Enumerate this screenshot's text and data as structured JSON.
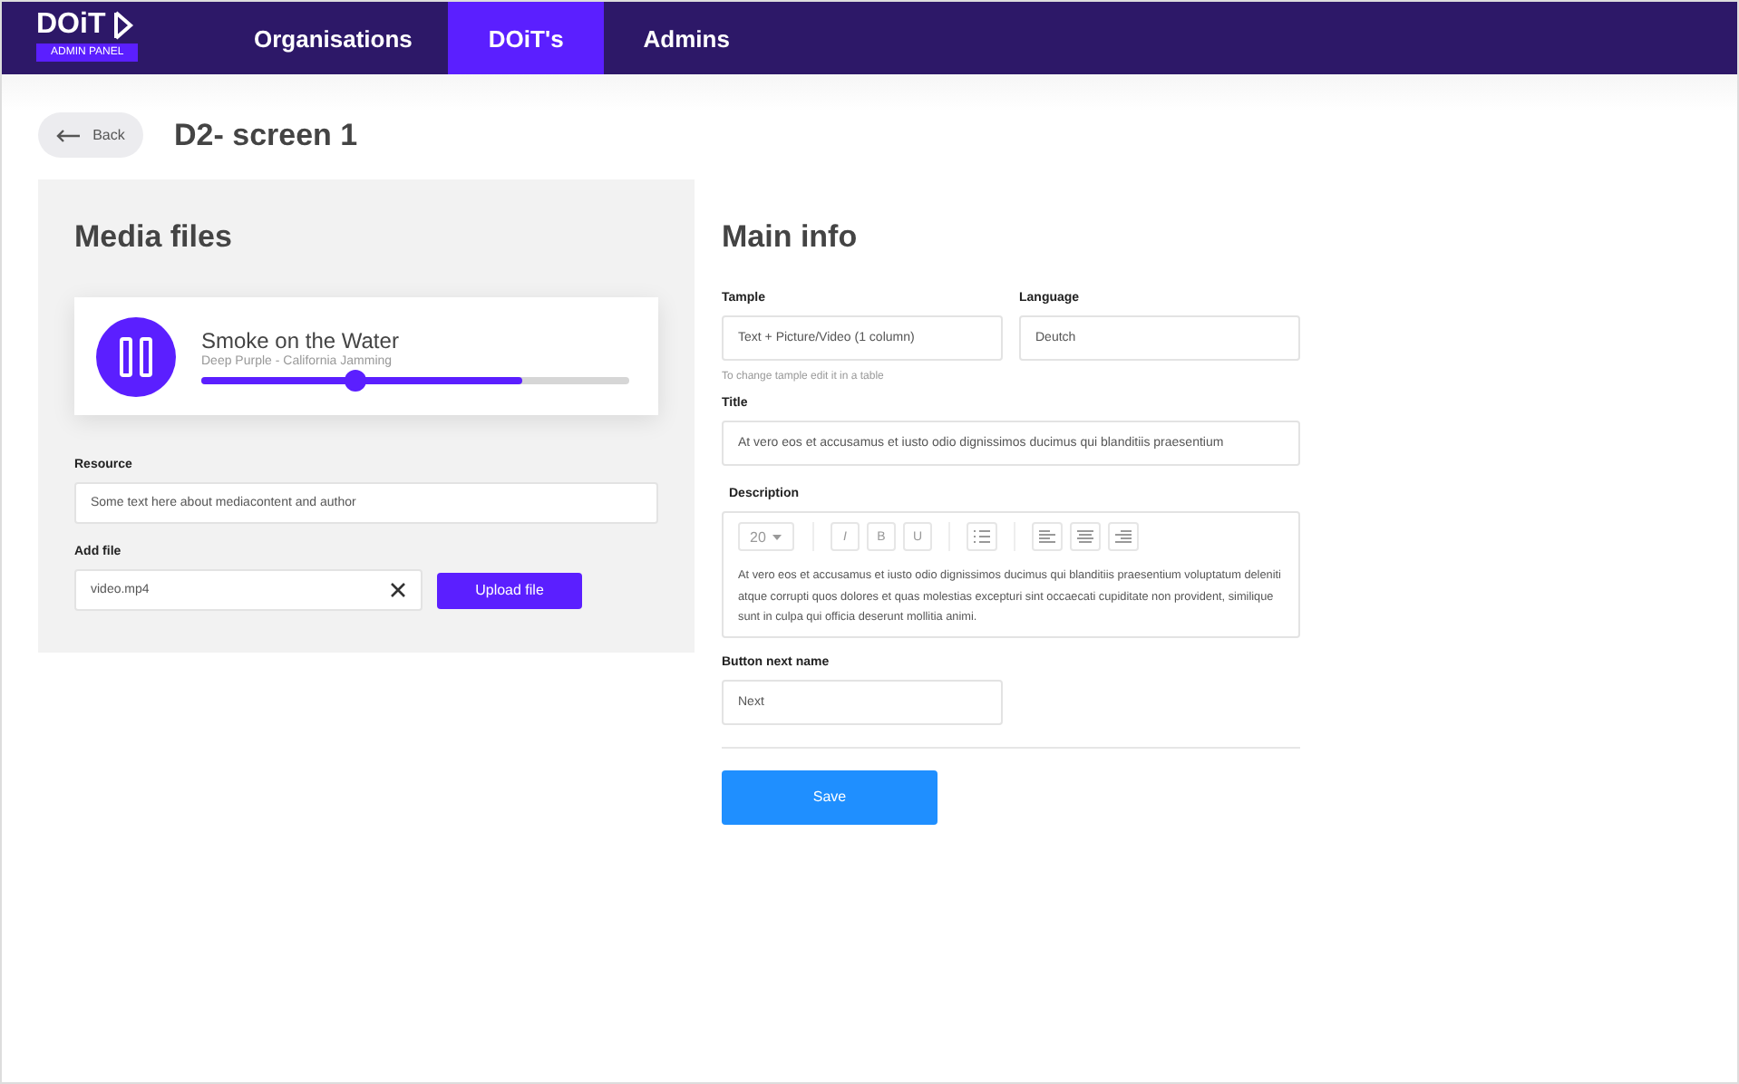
{
  "logo": {
    "text": "DOiT",
    "badge": "ADMIN PANEL"
  },
  "nav": [
    {
      "label": "Organisations",
      "selected": false
    },
    {
      "label": "DOiT's",
      "selected": true
    },
    {
      "label": "Admins",
      "selected": false
    }
  ],
  "back_button": "Back",
  "page_title": "D2- screen 1",
  "media": {
    "heading": "Media files",
    "player": {
      "title": "Smoke on the Water",
      "subtitle": "Deep Purple - California Jamming",
      "playing": true,
      "buffer": {
        "level": 0.75
      },
      "position": {
        "level": 0.36
      }
    },
    "resource": {
      "label": "Resource",
      "value": "Some text here about mediacontent and author"
    },
    "add_file": {
      "label": "Add file",
      "value": "video.mp4",
      "upload_button": "Upload file"
    }
  },
  "main": {
    "heading": "Main info",
    "template": {
      "label": "Tample",
      "value": "Text + Picture/Video (1 column)",
      "hint": "To change tample edit it in a table"
    },
    "language": {
      "label": "Language",
      "value": "Deutch"
    },
    "title": {
      "label": "Title",
      "value": "At vero eos et accusamus et iusto odio dignissimos ducimus qui blanditiis praesentium"
    },
    "description": {
      "label": "Description",
      "font_size": "20",
      "tools": [
        {
          "kind": "text",
          "label": "I"
        },
        {
          "kind": "text",
          "label": "B"
        },
        {
          "kind": "text",
          "label": "U"
        },
        {
          "kind": "list"
        },
        {
          "kind": "align-left"
        },
        {
          "kind": "align-center"
        },
        {
          "kind": "align-right"
        }
      ],
      "value": "At vero eos et accusamus et iusto odio dignissimos ducimus qui blanditiis praesentium voluptatum deleniti atque corrupti quos dolores et quas molestias excepturi sint occaecati cupiditate non provident, similique sunt in culpa qui officia deserunt mollitia animi."
    },
    "button_next": {
      "label": "Button next name",
      "value": "Next"
    },
    "save_button": "Save"
  }
}
